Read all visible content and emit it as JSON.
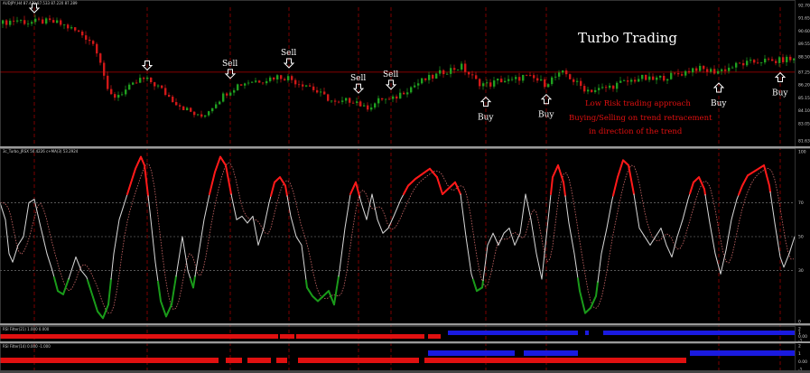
{
  "chart_data": [
    {
      "type": "candlestick",
      "panel": "price",
      "header": "AUDJPY,H4  87.479 87.533 87.220 87.289",
      "title": "Turbo Trading",
      "annotations": [
        "Low Risk trading approach",
        "Buying/Selling on trend retracement",
        "in direction of the trend"
      ],
      "y_ticks": [
        "92.70",
        "91.65",
        "90.60",
        "89.55",
        "88.50",
        "87.25",
        "86.20",
        "85.15",
        "84.10",
        "83.05",
        "81.63"
      ],
      "price_line": "87.25",
      "close_path": [
        [
          0,
          91.2
        ],
        [
          8,
          91.4
        ],
        [
          18,
          91.5
        ],
        [
          30,
          91.3
        ],
        [
          45,
          91.4
        ],
        [
          60,
          91.3
        ],
        [
          72,
          91.0
        ],
        [
          88,
          90.4
        ],
        [
          100,
          89.8
        ],
        [
          108,
          88.8
        ],
        [
          114,
          87.0
        ],
        [
          118,
          85.6
        ],
        [
          124,
          85.2
        ],
        [
          134,
          85.6
        ],
        [
          145,
          86.1
        ],
        [
          155,
          86.7
        ],
        [
          165,
          86.5
        ],
        [
          175,
          86.0
        ],
        [
          185,
          85.3
        ],
        [
          195,
          84.7
        ],
        [
          205,
          84.2
        ],
        [
          214,
          83.8
        ],
        [
          220,
          83.5
        ],
        [
          228,
          84.0
        ],
        [
          238,
          84.8
        ],
        [
          250,
          85.6
        ],
        [
          262,
          86.2
        ],
        [
          275,
          86.5
        ],
        [
          290,
          86.6
        ],
        [
          305,
          86.9
        ],
        [
          318,
          86.8
        ],
        [
          328,
          86.4
        ],
        [
          340,
          86.2
        ],
        [
          352,
          85.5
        ],
        [
          362,
          85.1
        ],
        [
          372,
          84.6
        ],
        [
          382,
          84.9
        ],
        [
          392,
          85.0
        ],
        [
          402,
          84.3
        ],
        [
          412,
          84.6
        ],
        [
          422,
          85.1
        ],
        [
          432,
          84.9
        ],
        [
          444,
          85.6
        ],
        [
          456,
          86.1
        ],
        [
          468,
          86.6
        ],
        [
          480,
          86.9
        ],
        [
          490,
          87.3
        ],
        [
          500,
          87.5
        ],
        [
          510,
          87.7
        ],
        [
          518,
          87.1
        ],
        [
          528,
          86.4
        ],
        [
          540,
          86.2
        ],
        [
          552,
          86.6
        ],
        [
          565,
          86.5
        ],
        [
          578,
          86.9
        ],
        [
          590,
          86.7
        ],
        [
          602,
          86.3
        ],
        [
          612,
          86.8
        ],
        [
          624,
          87.2
        ],
        [
          636,
          86.4
        ],
        [
          648,
          85.8
        ],
        [
          660,
          85.8
        ],
        [
          672,
          86.0
        ],
        [
          684,
          86.3
        ],
        [
          696,
          86.5
        ],
        [
          708,
          86.8
        ],
        [
          720,
          86.6
        ],
        [
          732,
          86.8
        ],
        [
          744,
          87.0
        ],
        [
          756,
          87.2
        ],
        [
          768,
          87.6
        ],
        [
          780,
          87.4
        ],
        [
          792,
          87.3
        ],
        [
          806,
          87.6
        ],
        [
          818,
          87.9
        ],
        [
          830,
          88.0
        ],
        [
          842,
          88.2
        ],
        [
          856,
          88.1
        ],
        [
          868,
          88.3
        ],
        [
          880,
          88.3
        ]
      ],
      "x_range": [
        0,
        880
      ],
      "y_range": [
        81.63,
        92.7
      ],
      "signals": [
        {
          "x": 38,
          "label": ""
        },
        {
          "x": 163,
          "label": ""
        },
        {
          "x": 255,
          "label": "Sell"
        },
        {
          "x": 320,
          "label": "Sell"
        },
        {
          "x": 397,
          "label": "Sell"
        },
        {
          "x": 433,
          "label": "Sell"
        },
        {
          "x": 538,
          "label": "Buy"
        },
        {
          "x": 605,
          "label": "Buy"
        },
        {
          "x": 796,
          "label": "Buy"
        },
        {
          "x": 864,
          "label": "Buy"
        }
      ]
    },
    {
      "type": "line",
      "panel": "oscillator",
      "header": "3c_Turbo_JRSX 50.4226  c+MA(3) 53.2924",
      "y_ticks": [
        "100",
        "70",
        "50",
        "30",
        "0"
      ],
      "y_range": [
        0,
        100
      ],
      "x_range": [
        0,
        880
      ],
      "series": [
        {
          "values": [
            [
              0,
              70
            ],
            [
              6,
              60
            ],
            [
              10,
              40
            ],
            [
              14,
              35
            ],
            [
              20,
              45
            ],
            [
              26,
              50
            ],
            [
              32,
              70
            ],
            [
              38,
              72
            ],
            [
              44,
              58
            ],
            [
              52,
              40
            ],
            [
              58,
              30
            ],
            [
              64,
              18
            ],
            [
              70,
              16
            ],
            [
              76,
              25
            ],
            [
              84,
              38
            ],
            [
              90,
              30
            ],
            [
              96,
              26
            ],
            [
              102,
              16
            ],
            [
              108,
              6
            ],
            [
              114,
              2
            ],
            [
              120,
              10
            ],
            [
              126,
              40
            ],
            [
              132,
              60
            ],
            [
              138,
              70
            ],
            [
              144,
              80
            ],
            [
              150,
              90
            ],
            [
              156,
              97
            ],
            [
              160,
              92
            ],
            [
              166,
              65
            ],
            [
              172,
              35
            ],
            [
              178,
              12
            ],
            [
              184,
              3
            ],
            [
              190,
              10
            ],
            [
              196,
              30
            ],
            [
              202,
              50
            ],
            [
              208,
              30
            ],
            [
              214,
              20
            ],
            [
              220,
              40
            ],
            [
              226,
              60
            ],
            [
              232,
              75
            ],
            [
              238,
              88
            ],
            [
              244,
              97
            ],
            [
              250,
              92
            ],
            [
              256,
              75
            ],
            [
              262,
              60
            ],
            [
              268,
              62
            ],
            [
              274,
              58
            ],
            [
              280,
              62
            ],
            [
              286,
              45
            ],
            [
              292,
              55
            ],
            [
              298,
              70
            ],
            [
              304,
              82
            ],
            [
              310,
              85
            ],
            [
              316,
              80
            ],
            [
              322,
              62
            ],
            [
              328,
              50
            ],
            [
              334,
              45
            ],
            [
              340,
              20
            ],
            [
              346,
              15
            ],
            [
              352,
              12
            ],
            [
              358,
              15
            ],
            [
              364,
              18
            ],
            [
              370,
              10
            ],
            [
              376,
              30
            ],
            [
              382,
              55
            ],
            [
              388,
              75
            ],
            [
              394,
              82
            ],
            [
              400,
              70
            ],
            [
              406,
              60
            ],
            [
              412,
              75
            ],
            [
              418,
              60
            ],
            [
              424,
              52
            ],
            [
              430,
              55
            ],
            [
              436,
              62
            ],
            [
              444,
              72
            ],
            [
              452,
              80
            ],
            [
              460,
              84
            ],
            [
              468,
              87
            ],
            [
              476,
              90
            ],
            [
              484,
              85
            ],
            [
              490,
              75
            ],
            [
              496,
              78
            ],
            [
              504,
              82
            ],
            [
              510,
              75
            ],
            [
              516,
              50
            ],
            [
              522,
              28
            ],
            [
              528,
              18
            ],
            [
              534,
              20
            ],
            [
              540,
              45
            ],
            [
              546,
              52
            ],
            [
              552,
              45
            ],
            [
              558,
              52
            ],
            [
              564,
              55
            ],
            [
              570,
              45
            ],
            [
              576,
              52
            ],
            [
              582,
              75
            ],
            [
              588,
              60
            ],
            [
              594,
              40
            ],
            [
              600,
              25
            ],
            [
              606,
              55
            ],
            [
              612,
              85
            ],
            [
              618,
              92
            ],
            [
              624,
              82
            ],
            [
              630,
              58
            ],
            [
              636,
              40
            ],
            [
              642,
              18
            ],
            [
              648,
              5
            ],
            [
              654,
              8
            ],
            [
              660,
              15
            ],
            [
              666,
              40
            ],
            [
              672,
              55
            ],
            [
              678,
              72
            ],
            [
              684,
              85
            ],
            [
              690,
              95
            ],
            [
              696,
              92
            ],
            [
              702,
              75
            ],
            [
              708,
              55
            ],
            [
              714,
              50
            ],
            [
              720,
              45
            ],
            [
              726,
              50
            ],
            [
              732,
              55
            ],
            [
              738,
              45
            ],
            [
              744,
              38
            ],
            [
              750,
              50
            ],
            [
              756,
              60
            ],
            [
              762,
              72
            ],
            [
              768,
              82
            ],
            [
              774,
              85
            ],
            [
              780,
              78
            ],
            [
              786,
              58
            ],
            [
              792,
              40
            ],
            [
              798,
              28
            ],
            [
              804,
              42
            ],
            [
              810,
              60
            ],
            [
              816,
              72
            ],
            [
              822,
              80
            ],
            [
              828,
              86
            ],
            [
              834,
              88
            ],
            [
              840,
              90
            ],
            [
              846,
              92
            ],
            [
              852,
              80
            ],
            [
              858,
              58
            ],
            [
              864,
              38
            ],
            [
              868,
              32
            ],
            [
              874,
              40
            ],
            [
              880,
              50
            ]
          ]
        },
        {
          "values": []
        }
      ],
      "colors": {
        "up": "#ff1a1a",
        "down": "#1a9a1a",
        "mid": "#d8d8d8",
        "ma": "#d06a6a"
      }
    },
    {
      "type": "bar",
      "panel": "filter-1",
      "header": "RSI Filter(21) 1.000 0.000",
      "y_ticks": [
        "2",
        "1",
        "0.00",
        "-1"
      ],
      "segments": [
        {
          "from": 0,
          "to": 308,
          "color": "#e01010"
        },
        {
          "from": 310,
          "to": 326,
          "color": "#e01010"
        },
        {
          "from": 328,
          "to": 470,
          "color": "#e01010"
        },
        {
          "from": 474,
          "to": 488,
          "color": "#e01010"
        },
        {
          "from": 496,
          "to": 640,
          "color": "#1a1ae0"
        },
        {
          "from": 648,
          "to": 652,
          "color": "#1a1ae0"
        },
        {
          "from": 668,
          "to": 880,
          "color": "#1a1ae0"
        }
      ]
    },
    {
      "type": "bar",
      "panel": "filter-2",
      "header": "RSI Filter(14) 0.000 -1.000",
      "y_ticks": [
        "2",
        "1",
        "0.00",
        "-1"
      ],
      "segments": [
        {
          "from": 0,
          "to": 242,
          "color": "#e01010",
          "row": "low"
        },
        {
          "from": 250,
          "to": 268,
          "color": "#e01010",
          "row": "low"
        },
        {
          "from": 274,
          "to": 300,
          "color": "#e01010",
          "row": "low"
        },
        {
          "from": 306,
          "to": 318,
          "color": "#e01010",
          "row": "low"
        },
        {
          "from": 330,
          "to": 464,
          "color": "#e01010",
          "row": "low"
        },
        {
          "from": 474,
          "to": 570,
          "color": "#1a1ae0",
          "row": "high"
        },
        {
          "from": 580,
          "to": 640,
          "color": "#1a1ae0",
          "row": "high"
        },
        {
          "from": 470,
          "to": 760,
          "color": "#e01010",
          "row": "low"
        },
        {
          "from": 764,
          "to": 880,
          "color": "#1a1ae0",
          "row": "high"
        }
      ]
    }
  ]
}
